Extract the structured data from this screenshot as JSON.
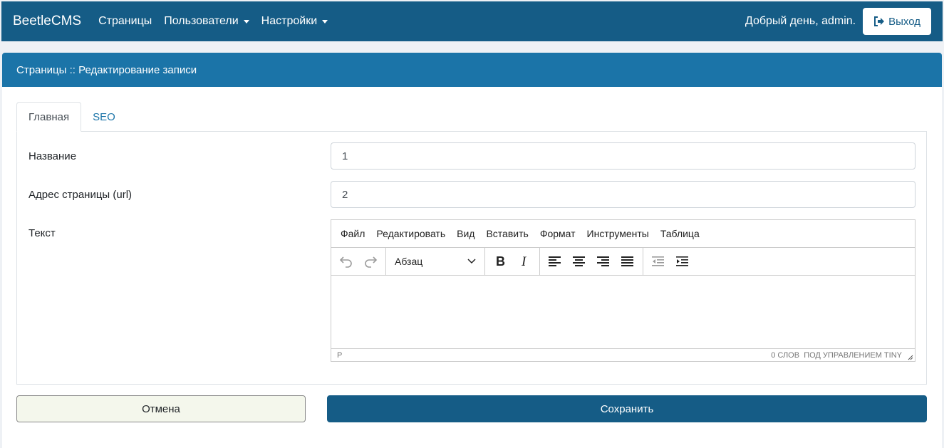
{
  "navbar": {
    "brand": "BeetleCMS",
    "links": [
      "Страницы",
      "Пользователи",
      "Настройки"
    ],
    "greeting": "Добрый день, admin.",
    "logout_label": "Выход"
  },
  "panel": {
    "title": "Страницы :: Редактирование записи"
  },
  "tabs": [
    {
      "label": "Главная",
      "active": true
    },
    {
      "label": "SEO",
      "active": false
    }
  ],
  "form": {
    "name_label": "Название",
    "name_value": "1",
    "url_label": "Адрес страницы (url)",
    "url_value": "2",
    "text_label": "Текст"
  },
  "editor": {
    "menu": [
      "Файл",
      "Редактировать",
      "Вид",
      "Вставить",
      "Формат",
      "Инструменты",
      "Таблица"
    ],
    "format_value": "Абзац",
    "status_path": "P",
    "word_count": "0 СЛОВ",
    "powered_by": "ПОД УПРАВЛЕНИЕМ TINY",
    "icons": [
      "undo-icon",
      "redo-icon",
      "bold-icon",
      "italic-icon",
      "align-left-icon",
      "align-center-icon",
      "align-right-icon",
      "align-justify-icon",
      "outdent-icon",
      "indent-icon"
    ]
  },
  "actions": {
    "cancel_label": "Отмена",
    "save_label": "Сохранить"
  },
  "colors": {
    "navbar": "#155c86",
    "panel_header": "#1b74a8",
    "cancel_bg": "#f4f7ec"
  }
}
